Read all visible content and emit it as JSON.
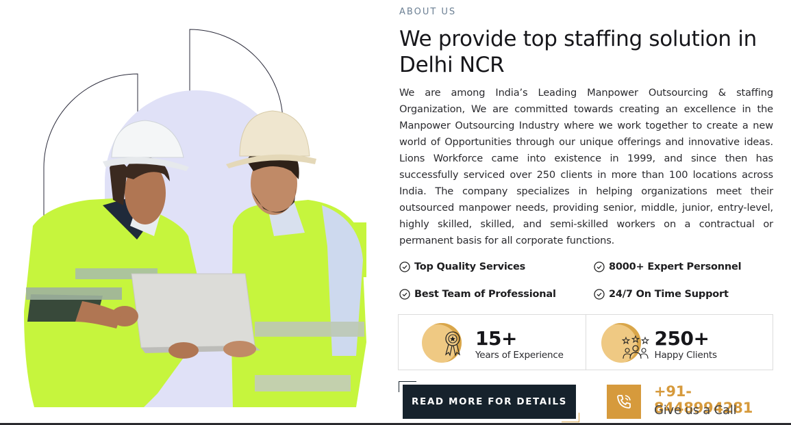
{
  "about": {
    "eyebrow": "ABOUT US",
    "heading": "We provide top staffing solution in Delhi NCR",
    "paragraph": "We are among India’s Leading Manpower Outsourcing & staffing Organization, We are committed towards creating an excellence in the Manpower Outsourcing Industry where we work together to create a new world of Opportunities through our unique offerings and innovative ideas. Lions Workforce came into existence in 1999, and since then has successfully serviced over 250 clients in more than 100 locations across India. The company specializes in helping organizations meet their outsourced manpower needs, providing senior, middle, junior, entry-level, highly skilled, skilled, and semi-skilled workers on a contractual or permanent basis for all corporate functions."
  },
  "features": [
    {
      "label": "Top Quality Services",
      "icon": "check-circle-icon"
    },
    {
      "label": "8000+ Expert Personnel",
      "icon": "check-circle-icon"
    },
    {
      "label": "Best Team of Professional",
      "icon": "check-circle-icon"
    },
    {
      "label": "24/7 On Time Support",
      "icon": "check-circle-icon"
    }
  ],
  "stats": [
    {
      "value": "15+",
      "label": "Years of Experience",
      "icon": "award-medal-icon"
    },
    {
      "value": "250+",
      "label": "Happy Clients",
      "icon": "team-stars-icon"
    }
  ],
  "cta": {
    "button_label": "READ MORE FOR DETAILS",
    "phone": "+91-8448994281",
    "phone_caption": "Give us a Call",
    "phone_icon": "phone-call-icon"
  },
  "colors": {
    "accent": "#d69a3c",
    "dark": "#16222c",
    "vest": "#c6f53d",
    "backdrop": "#e0e1f7"
  },
  "image": {
    "subject": "two-workers-hardhats-laptop-illustration"
  }
}
